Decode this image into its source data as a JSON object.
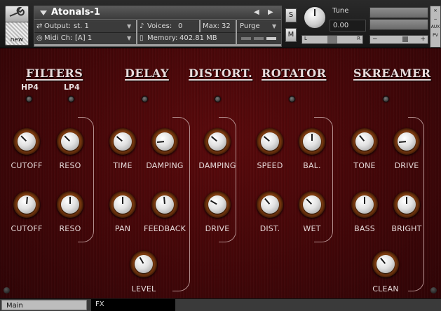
{
  "header": {
    "instrument_name": "Atonals-1",
    "new_label": "new",
    "output_label": "Output:",
    "output_value": "st. 1",
    "voices_label": "Voices:",
    "voices_value": "0",
    "max_label": "Max:",
    "max_value": "32",
    "purge_label": "Purge",
    "midi_label": "Midi Ch:",
    "midi_value": "[A]  1",
    "memory_label": "Memory:",
    "memory_value": "402.81 MB",
    "solo_label": "S",
    "mute_label": "M",
    "tune_label": "Tune",
    "tune_value": "0.00",
    "pan_left": "L",
    "pan_right": "R",
    "aux_label": "AUX",
    "pv_label": "PV"
  },
  "sections": {
    "filters": {
      "title": "FILTERS",
      "hp4": "HP4",
      "lp4": "LP4"
    },
    "delay": {
      "title": "DELAY"
    },
    "distort": {
      "title": "DISTORT."
    },
    "rotator": {
      "title": "ROTATOR"
    },
    "skreamer": {
      "title": "SKREAMER"
    }
  },
  "knobs": [
    {
      "label": "CUTOFF",
      "angle": -45
    },
    {
      "label": "RESO",
      "angle": -45
    },
    {
      "label": "CUTOFF",
      "angle": 5
    },
    {
      "label": "RESO",
      "angle": 0
    },
    {
      "label": "TIME",
      "angle": -50
    },
    {
      "label": "DAMPING",
      "angle": -95
    },
    {
      "label": "PAN",
      "angle": 0
    },
    {
      "label": "FEEDBACK",
      "angle": -5
    },
    {
      "label": "LEVEL",
      "angle": -30
    },
    {
      "label": "DAMPING",
      "angle": -50
    },
    {
      "label": "DRIVE",
      "angle": -60
    },
    {
      "label": "SPEED",
      "angle": -50
    },
    {
      "label": "BAL.",
      "angle": 0
    },
    {
      "label": "DIST.",
      "angle": -40
    },
    {
      "label": "WET",
      "angle": -45
    },
    {
      "label": "TONE",
      "angle": -40
    },
    {
      "label": "DRIVE",
      "angle": -95
    },
    {
      "label": "BASS",
      "angle": 0
    },
    {
      "label": "BRIGHT",
      "angle": 0
    },
    {
      "label": "CLEAN",
      "angle": -40
    }
  ],
  "footer": {
    "tab_main": "Main",
    "tab_fx": "FX"
  },
  "colors": {
    "panel_red": "#4a080a",
    "knob_ring": "#7d3b10",
    "text": "#e8dcdc"
  }
}
